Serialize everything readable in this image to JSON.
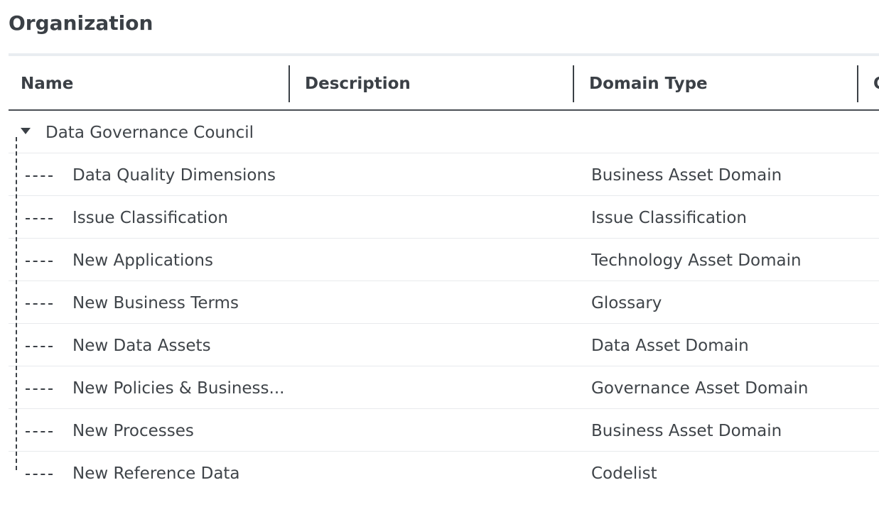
{
  "page": {
    "title": "Organization"
  },
  "grid": {
    "columns": [
      {
        "key": "name",
        "label": "Name"
      },
      {
        "key": "description",
        "label": "Description"
      },
      {
        "key": "domain_type",
        "label": "Domain Type"
      },
      {
        "key": "partial",
        "label": "C"
      }
    ],
    "parent": {
      "name": "Data Governance Council",
      "description": "",
      "domain_type": "",
      "expanded": true
    },
    "children": [
      {
        "name": "Data Quality Dimensions",
        "description": "",
        "domain_type": "Business Asset Domain"
      },
      {
        "name": "Issue Classification",
        "description": "",
        "domain_type": "Issue Classification"
      },
      {
        "name": "New Applications",
        "description": "",
        "domain_type": "Technology Asset Domain"
      },
      {
        "name": "New Business Terms",
        "description": "",
        "domain_type": "Glossary"
      },
      {
        "name": "New Data Assets",
        "description": "",
        "domain_type": "Data Asset Domain"
      },
      {
        "name": "New Policies & Business...",
        "description": "",
        "domain_type": "Governance Asset Domain"
      },
      {
        "name": "New Processes",
        "description": "",
        "domain_type": "Business Asset Domain"
      },
      {
        "name": "New Reference Data",
        "description": "",
        "domain_type": "Codelist"
      }
    ]
  },
  "icons": {
    "expander": "caret-down-icon"
  },
  "colors": {
    "text": "#3f4449",
    "header_text": "#3b4046",
    "row_divider": "#e8eaed",
    "title_rule": "#e9edf1"
  }
}
